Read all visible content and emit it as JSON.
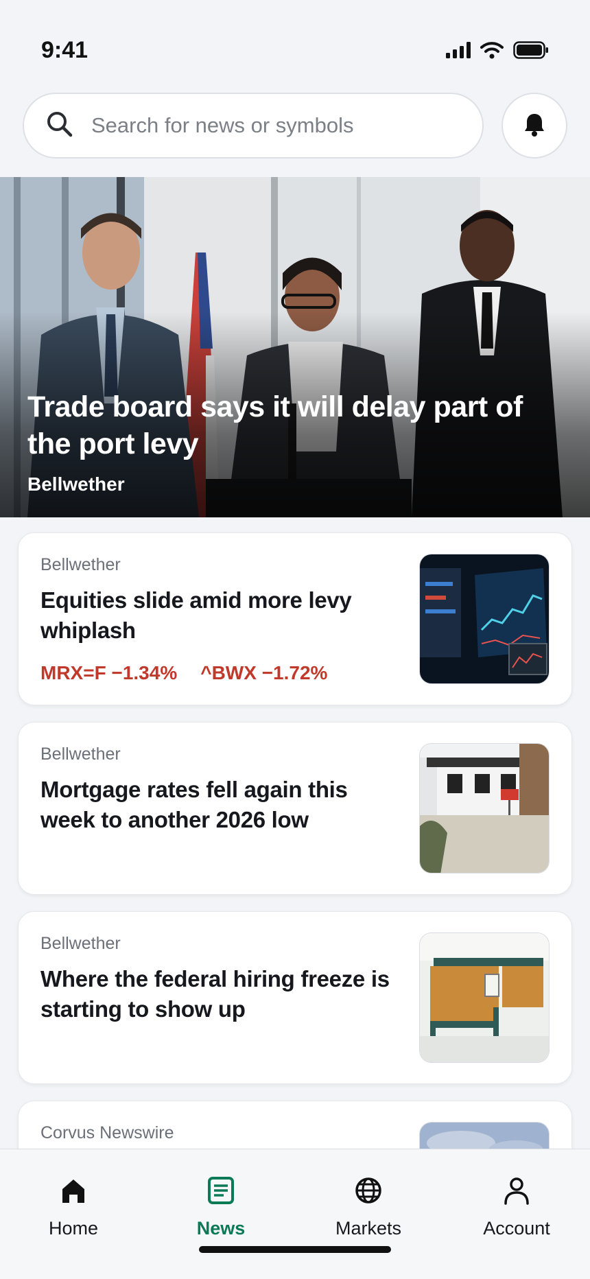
{
  "status_bar": {
    "time": "9:41",
    "icons": [
      "signal-icon",
      "wifi-icon",
      "battery-icon"
    ]
  },
  "search": {
    "placeholder": "Search for news or symbols",
    "icon": "search-icon"
  },
  "header": {
    "bell_icon": "bell-icon"
  },
  "hero": {
    "title": "Trade board says it will delay part of the port levy",
    "source": "Bellwether"
  },
  "articles": [
    {
      "source": "Bellwether",
      "title": "Equities slide amid more levy whiplash",
      "tickers": [
        {
          "symbol": "MRX=F",
          "change": "−1.34%"
        },
        {
          "symbol": "^BWX",
          "change": "−1.72%"
        }
      ],
      "thumbnail": "trading-screens"
    },
    {
      "source": "Bellwether",
      "title": "Mortgage rates fell again this week to another 2026 low",
      "thumbnail": "house-for-sale"
    },
    {
      "source": "Bellwether",
      "title": "Where the federal hiring freeze is starting to show up",
      "thumbnail": "empty-office"
    },
    {
      "source": "Corvus Newswire",
      "title": "",
      "thumbnail": "sky"
    }
  ],
  "nav": {
    "items": [
      {
        "label": "Home",
        "icon": "home-icon",
        "active": false
      },
      {
        "label": "News",
        "icon": "news-icon",
        "active": true
      },
      {
        "label": "Markets",
        "icon": "globe-icon",
        "active": false
      },
      {
        "label": "Account",
        "icon": "person-icon",
        "active": false
      }
    ]
  },
  "colors": {
    "accent": "#0b7a55",
    "negative": "#c0392b",
    "background": "#f2f4f7"
  }
}
